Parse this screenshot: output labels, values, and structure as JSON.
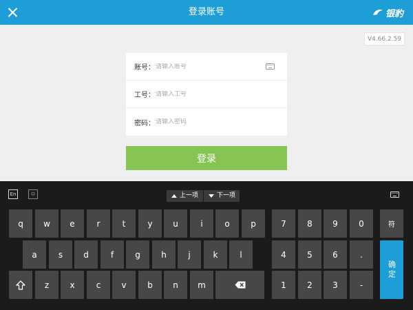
{
  "header": {
    "title": "登录账号",
    "brand": "银豹"
  },
  "version": "V4.66.2.59",
  "form": {
    "account_label": "账号：",
    "account_placeholder": "请输入账号",
    "account_value": "",
    "jobno_label": "工号：",
    "jobno_placeholder": "请输入工号",
    "jobno_value": "",
    "password_label": "密码：",
    "password_placeholder": "请输入密码",
    "password_value": ""
  },
  "login_button": "登录",
  "keyboard": {
    "mode_english": "En",
    "mode_chinese": "中",
    "prev_label": "上一项",
    "next_label": "下一项",
    "row1": [
      "q",
      "w",
      "e",
      "r",
      "t",
      "y",
      "u",
      "i",
      "o",
      "p"
    ],
    "row2": [
      "a",
      "s",
      "d",
      "f",
      "g",
      "h",
      "j",
      "k",
      "l"
    ],
    "row3": [
      "z",
      "x",
      "c",
      "v",
      "b",
      "n",
      "m"
    ],
    "num_row1": [
      "7",
      "8",
      "9",
      "0"
    ],
    "num_row2": [
      "4",
      "5",
      "6",
      "."
    ],
    "num_row3": [
      "1",
      "2",
      "3",
      "-"
    ],
    "symbol": "符",
    "confirm": "确定"
  },
  "colors": {
    "header": "#1e9ed6",
    "login": "#86c454",
    "keyboard_bg": "#1b1b1b",
    "key": "#474747",
    "confirm": "#1e9ed6"
  }
}
